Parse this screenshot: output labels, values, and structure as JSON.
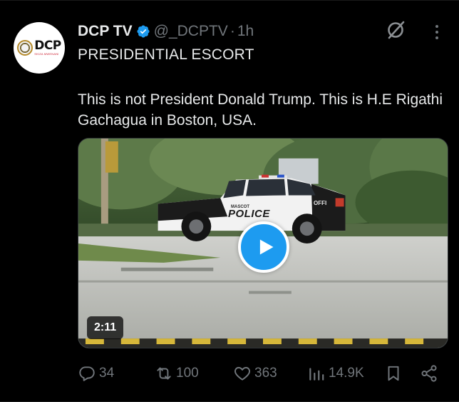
{
  "author": {
    "display_name": "DCP TV",
    "handle": "@_DCPTV",
    "separator": "·",
    "time_ago": "1h",
    "avatar": {
      "logo_text": "DCP",
      "logo_subtext": "SKIZA MWENANI"
    }
  },
  "post": {
    "headline": "PRESIDENTIAL ESCORT",
    "text": "This is not President Donald Trump. This is H.E Rigathi Gachagua in Boston, USA."
  },
  "media": {
    "type": "video",
    "duration": "2:11",
    "vehicle_door_text": "POLICE",
    "vehicle_small_text": "MASCOT",
    "vehicle_fender_text": "OFFI"
  },
  "actions": {
    "replies": "34",
    "reposts": "100",
    "likes": "363",
    "views": "14.9K"
  },
  "icons": {
    "verified": "verified-badge-icon",
    "grok": "grok-icon",
    "more": "more-icon",
    "play": "play-icon",
    "reply": "reply-icon",
    "repost": "repost-icon",
    "like": "heart-icon",
    "views": "views-icon",
    "bookmark": "bookmark-icon",
    "share": "share-icon"
  },
  "colors": {
    "background": "#000000",
    "text_primary": "#e7e9ea",
    "text_secondary": "#71767b",
    "accent": "#1d9bf0"
  }
}
